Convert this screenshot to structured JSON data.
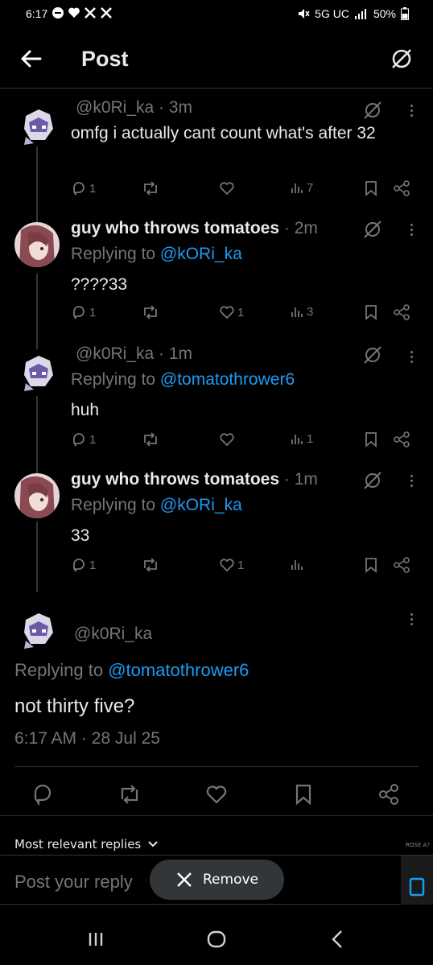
{
  "status": {
    "time": "6:17",
    "network": "5G UC",
    "battery": "50%"
  },
  "header": {
    "title": "Post"
  },
  "replies": [
    {
      "handle": "@k0Ri_ka",
      "time": "3m",
      "text": "omfg i actually cant count what's after 32",
      "replying_to": "",
      "counts": {
        "reply": "1",
        "repost": "",
        "like": "",
        "views": "7"
      }
    },
    {
      "name": "guy who throws tomatoes",
      "time": "2m",
      "replying_label": "Replying to",
      "replying_to": "@kORi_ka",
      "text": "????33",
      "counts": {
        "reply": "1",
        "repost": "",
        "like": "1",
        "views": "3"
      }
    },
    {
      "handle": "@k0Ri_ka",
      "time": "1m",
      "replying_label": "Replying to",
      "replying_to": "@tomatothrower6",
      "text": "huh",
      "counts": {
        "reply": "1",
        "repost": "",
        "like": "",
        "views": "1"
      }
    },
    {
      "name": "guy who throws tomatoes",
      "time": "1m",
      "replying_label": "Replying to",
      "replying_to": "@kORi_ka",
      "text": "33",
      "counts": {
        "reply": "1",
        "repost": "",
        "like": "1",
        "views": ""
      }
    }
  ],
  "main_post": {
    "handle": "@k0Ri_ka",
    "replying_label": "Replying to",
    "replying_to": "@tomatothrower6",
    "text": "not thirty five?",
    "timestamp": "6:17 AM · 28 Jul 25"
  },
  "sort_label": "Most relevant replies",
  "compose_placeholder": "Post your reply",
  "toast": {
    "label": "Remove"
  },
  "media_badge": "ROSE A?",
  "colors": {
    "accent": "#1d9bf0",
    "muted": "#71767b",
    "text": "#e7e9ea",
    "bg": "#000000"
  },
  "icons": [
    "back-arrow-icon",
    "grok-icon",
    "more-icon",
    "reply-icon",
    "repost-icon",
    "like-icon",
    "views-icon",
    "bookmark-icon",
    "share-icon"
  ]
}
